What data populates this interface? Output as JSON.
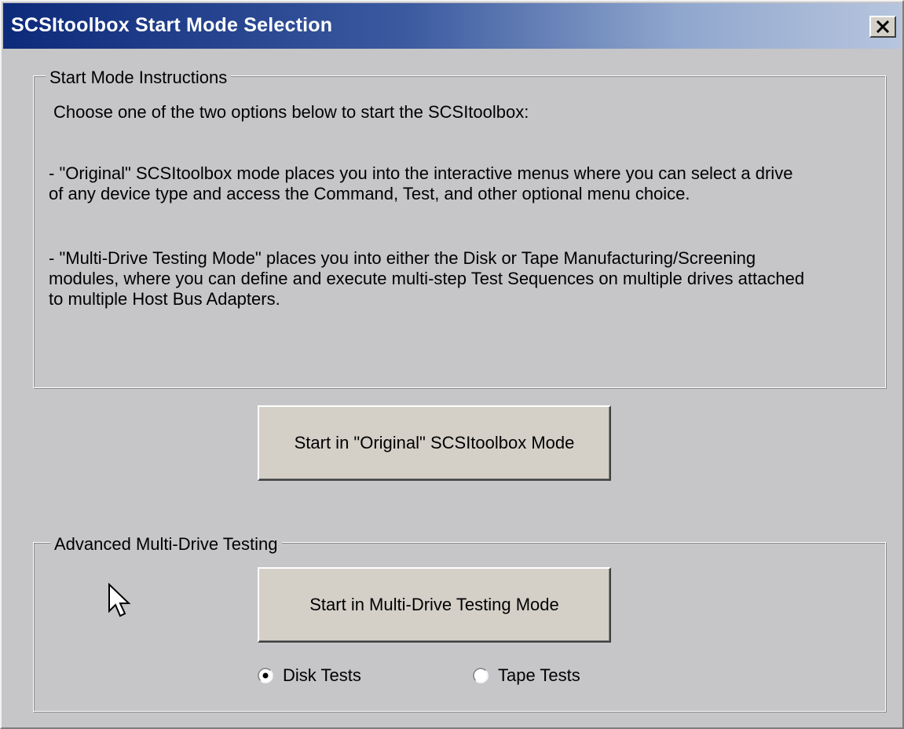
{
  "window": {
    "title": "SCSItoolbox Start Mode Selection",
    "close_label": "X"
  },
  "instructions_group": {
    "legend": "Start Mode Instructions",
    "intro": "Choose one of the two options below to start the SCSItoolbox:",
    "original_desc": "- \"Original\" SCSItoolbox mode places you into the interactive menus where you can select a drive of any device type and access the Command, Test, and other optional menu choice.",
    "multidrive_desc": "- \"Multi-Drive Testing Mode\" places you into either the Disk or Tape Manufacturing/Screening modules, where you can define and execute multi-step Test Sequences on multiple drives attached to multiple Host Bus Adapters."
  },
  "original_button": {
    "label": "Start in \"Original\" SCSItoolbox Mode"
  },
  "advanced_group": {
    "legend": "Advanced Multi-Drive Testing",
    "start_button_label": "Start in Multi-Drive Testing Mode",
    "options": [
      {
        "label": "Disk Tests",
        "selected": true
      },
      {
        "label": "Tape Tests",
        "selected": false
      }
    ]
  },
  "icons": {
    "close": "close-icon",
    "cursor": "mouse-pointer-icon",
    "radio_on": "radio-selected-icon",
    "radio_off": "radio-unselected-icon"
  }
}
